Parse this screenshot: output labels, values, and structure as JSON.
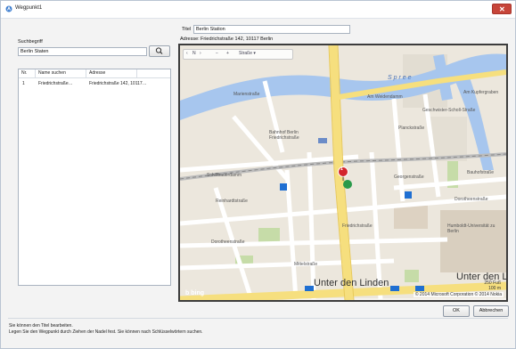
{
  "window": {
    "title": "Wegpunkt1",
    "close_glyph": "✕"
  },
  "form": {
    "title_label": "Titel",
    "title_value": "Berlin Station",
    "address_label": "Adresse:",
    "address_value": "Friedrichstraße 142, 10117 Berlin",
    "search_label": "Suchbegriff",
    "search_value": "Berlin Staten"
  },
  "table": {
    "columns": [
      "Nr.",
      "Name suchen",
      "Adresse"
    ],
    "rows": [
      {
        "nr": "1",
        "name": "Friedrichstraße…",
        "address": "Friedrichstraße 142, 10117…"
      }
    ]
  },
  "map": {
    "nav": {
      "left_glyph": "‹",
      "north": "N",
      "right_glyph": "›",
      "zoom_out": "−",
      "zoom_in": "+",
      "mode": "Straße ▾"
    },
    "labels": {
      "spree": "S p r e e",
      "weidendamm": "Am Weidendamm",
      "schiffbauerdamm": "Schiffbauerdamm",
      "reinhardtstrasse": "Reinhardtstraße",
      "dorotheenstrasse": "Dorotheenstraße",
      "dorotheenstrasse2": "Dorotheenstraße",
      "mittelstrasse": "Mittelstraße",
      "friedrichstrasse": "Friedrichstraße",
      "unter_den_linden": "Unter den Linden",
      "unter_den_linden_right": "Unter den L",
      "georgenstrasse": "Georgenstraße",
      "bauhofstrasse": "Bauhofstraße",
      "marienstrasse": "Marienstraße",
      "planckstrasse": "Planckstraße",
      "geschwister_scholl": "Geschwister-Scholl-Straße",
      "am_kupfergraben": "Am Kupfergraben",
      "bahnhof": "Bahnhof Berlin Friedrichstraße",
      "humboldt": "Humboldt-Universität zu Berlin",
      "pin": "1"
    },
    "brand": "b bing",
    "scale_ft": "250 Fuß",
    "scale_m": "100 m",
    "copyright": "© 2014 Microsoft Corporation  © 2014 Nokia"
  },
  "buttons": {
    "ok": "OK",
    "cancel": "Abbrechen"
  },
  "footer": {
    "line1": "Sie können den Titel bearbeiten.",
    "line2": "Legen Sie den Wegpunkt durch Ziehen der Nadel fest. Sie können nach Schlüsselwörtern suchen."
  },
  "colors": {
    "map_bg": "#ece7dd",
    "water": "#a7c6ee",
    "major_road": "#f6df7e",
    "minor_road": "#ffffff",
    "pin": "#d3252b",
    "park": "#c6dca8"
  }
}
